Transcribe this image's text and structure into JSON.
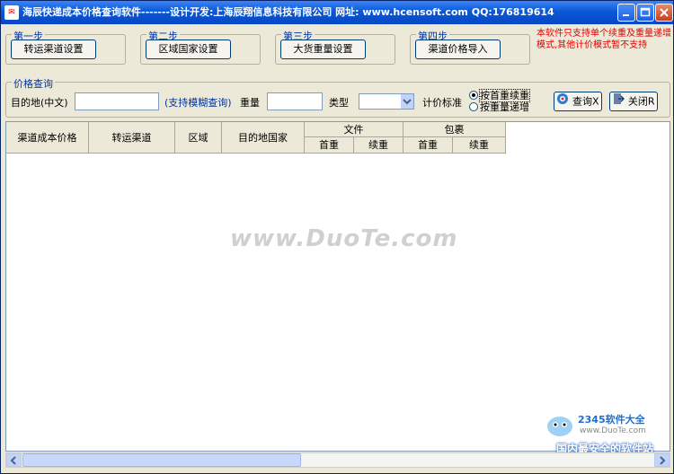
{
  "window": {
    "title": "海辰快递成本价格查询软件-------设计开发:上海辰翔信息科技有限公司 网址: www.hcensoft.com QQ:176819614"
  },
  "steps": [
    {
      "label": "第一步",
      "button": "转运渠道设置"
    },
    {
      "label": "第二步",
      "button": "区域国家设置"
    },
    {
      "label": "第三步",
      "button": "大货重量设置"
    },
    {
      "label": "第四步",
      "button": "渠道价格导入"
    }
  ],
  "note": "本软件只支持单个续重及重量递增模式,其他计价模式暂不支持",
  "query": {
    "group_label": "价格查询",
    "dest_label": "目的地(中文)",
    "dest_value": "",
    "fuzzy_hint": "(支持模糊查询)",
    "weight_label": "重量",
    "weight_value": "",
    "type_label": "类型",
    "type_value": "",
    "pricing_label": "计价标准",
    "radio_options": [
      "按首重续重",
      "按重量递增"
    ],
    "search_button": "查询X",
    "close_button": "关闭R"
  },
  "table": {
    "columns": [
      "渠道成本价格",
      "转运渠道",
      "区域",
      "目的地国家"
    ],
    "groups": [
      {
        "name": "文件",
        "sub": [
          "首重",
          "续重"
        ]
      },
      {
        "name": "包裹",
        "sub": [
          "首重",
          "续重"
        ]
      }
    ],
    "rows": []
  },
  "watermark": "www.DuoTe.com",
  "badge": {
    "line1": "2345软件大全",
    "line2": "www.DuoTe.com",
    "line3": "国内最安全的软件站"
  }
}
